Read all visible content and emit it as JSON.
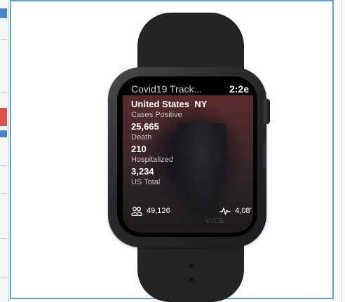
{
  "watch_app": {
    "title": "Covid19 Track...",
    "time": "2:2е",
    "country": "United States",
    "state": "NY",
    "metrics": [
      {
        "label": "Cases Positive",
        "value": "25,665"
      },
      {
        "label": "Death",
        "value": "210"
      },
      {
        "label": "Hospitalized",
        "value": "3,234"
      }
    ],
    "us_total_label": "US Total",
    "footer": {
      "people_icon": "people-icon",
      "people_value": "49,126",
      "activity_icon": "pulse-icon",
      "activity_value": "4,08’"
    }
  },
  "colors": {
    "frame_border": "#5aa3d6",
    "watch_case": "#2a2a2c",
    "strap": "#242424",
    "screen_bg": "#000000",
    "label_text": "#c4c4c4",
    "value_text": "#ffffff"
  }
}
